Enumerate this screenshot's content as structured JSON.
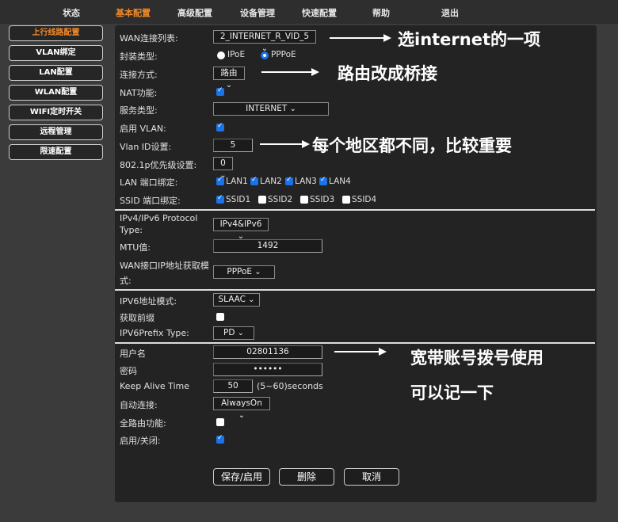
{
  "nav": [
    "状态",
    "基本配置",
    "高级配置",
    "设备管理",
    "快速配置",
    "帮助",
    "退出"
  ],
  "sidebar": [
    "上行线路配置",
    "VLAN绑定",
    "LAN配置",
    "WLAN配置",
    "WIFI定时开关",
    "远程管理",
    "限速配置"
  ],
  "form": {
    "wan_list_label": "WAN连接列表:",
    "wan_list_value": "2_INTERNET_R_VID_5",
    "encap_label": "封装类型:",
    "encap_ipoe": "IPoE",
    "encap_pppoe": "PPPoE",
    "conn_mode_label": "连接方式:",
    "conn_mode_value": "路由",
    "nat_label": "NAT功能:",
    "service_label": "服务类型:",
    "service_value": "INTERNET",
    "vlan_label": "启用 VLAN:",
    "vlan_id_label": "Vlan ID设置:",
    "vlan_id_value": "5",
    "priority_label": "802.1p优先级设置:",
    "priority_value": "0",
    "lan_bind_label": "LAN 端口绑定:",
    "lan_ports": [
      "LAN1",
      "LAN2",
      "LAN3",
      "LAN4"
    ],
    "ssid_bind_label": "SSID 端口绑定:",
    "ssids": [
      "SSID1",
      "SSID2",
      "SSID3",
      "SSID4"
    ],
    "protocol_label_1": "IPv4/IPv6 Protocol",
    "protocol_label_2": "Type:",
    "protocol_value": "IPv4&IPv6",
    "mtu_label": "MTU值:",
    "mtu_value": "1492",
    "ip_mode_label_1": "WAN接口IP地址获取模",
    "ip_mode_label_2": "式:",
    "ip_mode_value": "PPPoE",
    "ipv6_mode_label": "IPV6地址模式:",
    "ipv6_mode_value": "SLAAC",
    "prefix_label": "获取前缀",
    "prefix_type_label": "IPV6Prefix Type:",
    "prefix_type_value": "PD",
    "username_label": "用户名",
    "username_value": "02801136",
    "password_label": "密码",
    "password_value": "••••••",
    "keepalive_label": "Keep Alive Time",
    "keepalive_value": "50",
    "keepalive_unit": "(5~60)seconds",
    "auto_label": "自动连接:",
    "auto_value": "AlwaysOn",
    "fullroute_label": "全路由功能:",
    "enable_label": "启用/关闭:"
  },
  "buttons": {
    "save": "保存/启用",
    "delete": "删除",
    "cancel": "取消"
  },
  "annotations": [
    "选internet的一项",
    "路由改成桥接",
    "每个地区都不同，比较重要",
    "宽带账号拨号使用",
    "可以记一下"
  ]
}
